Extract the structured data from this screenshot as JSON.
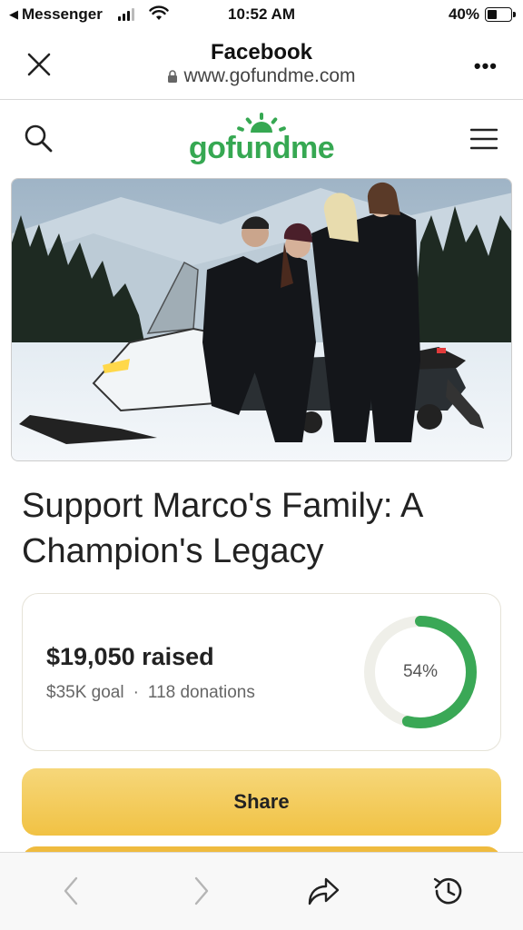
{
  "status_bar": {
    "back_app": "Messenger",
    "time": "10:52 AM",
    "battery": "40%"
  },
  "browser_bar": {
    "title": "Facebook",
    "url": "www.gofundme.com"
  },
  "site_header": {
    "logo_text": "gofundme",
    "brand_color": "#36a852"
  },
  "campaign": {
    "title": "Support Marco's Family: A Champion's Legacy",
    "raised": "$19,050 raised",
    "goal": "$35K goal",
    "separator": "·",
    "donations": "118 donations",
    "progress_label": "54%",
    "progress_fraction": 0.54
  },
  "actions": {
    "share_label": "Share"
  },
  "icons": {
    "close": "close-icon",
    "more": "more-icon",
    "lock": "lock-icon",
    "search": "search-icon",
    "menu": "hamburger-menu-icon",
    "back": "chevron-left-icon",
    "forward": "chevron-right-icon",
    "share": "share-arrow-icon",
    "history": "history-icon"
  }
}
